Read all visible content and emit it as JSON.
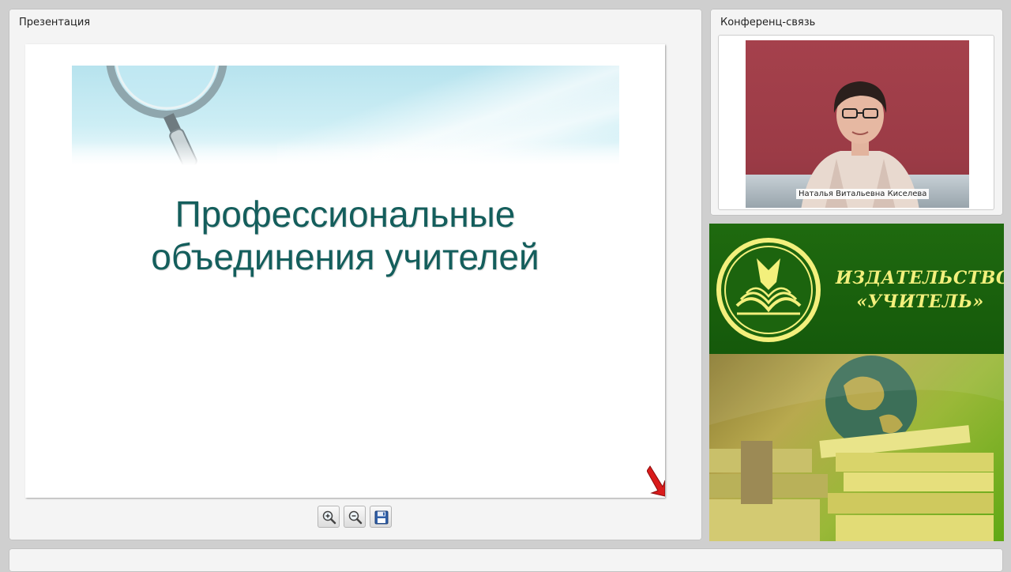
{
  "presentation": {
    "title": "Презентация",
    "slide_title_line1": "Профессиональные",
    "slide_title_line2": "объединения учителей"
  },
  "conference": {
    "title": "Конференц-связь",
    "speaker_name": "Наталья Витальевна Киселева"
  },
  "advertisement": {
    "line1": "ИЗДАТЕЛЬСТВО",
    "line2": "«УЧИТЕЛЬ»"
  },
  "colors": {
    "slide_title": "#145e5c",
    "ad_green": "#1f6a0f",
    "ad_text": "#f3f07c",
    "video_bg": "#a5414c"
  },
  "icons": {
    "zoom_in": "zoom-in-icon",
    "zoom_out": "zoom-out-icon",
    "save": "save-icon"
  }
}
